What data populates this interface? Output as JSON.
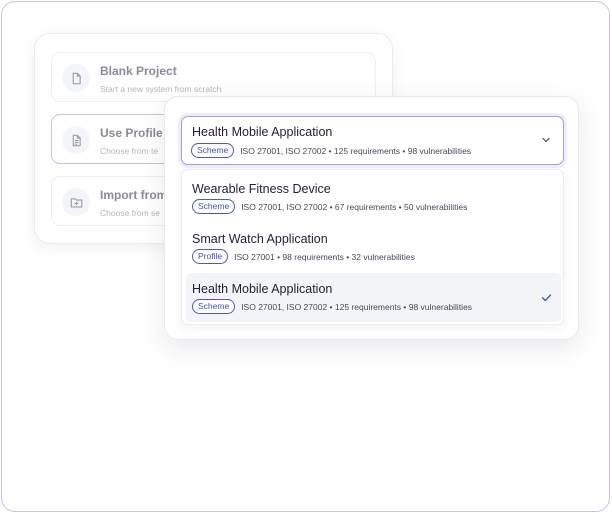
{
  "colors": {
    "accent": "#4a58c4",
    "frame_border": "#c9c3e6",
    "selected_border": "#a59ee0",
    "active_row": "#f3f4f8"
  },
  "project_options": [
    {
      "title": "Blank Project",
      "subtitle": "Start a new system from scratch",
      "icon": "document-icon"
    },
    {
      "title": "Use Profile o",
      "subtitle": "Choose from te",
      "icon": "document-text-icon"
    },
    {
      "title": "Import from",
      "subtitle": "Choose from se",
      "icon": "folder-plus-icon"
    }
  ],
  "select": {
    "title": "Health Mobile Application",
    "chip": "Scheme",
    "meta": "ISO 27001, ISO 27002 • 125 requirements • 98 vulnerabilities",
    "icon": "chevron-down-icon"
  },
  "menu_items": [
    {
      "title": "Wearable Fitness Device",
      "chip": "Scheme",
      "meta": "ISO 27001, ISO 27002 • 67 requirements • 50 vulnerabilities",
      "selected": false
    },
    {
      "title": "Smart Watch Application",
      "chip": "Profile",
      "meta": "ISO 27001 • 98 requirements • 32 vulnerabilities",
      "selected": false
    },
    {
      "title": "Health Mobile Application",
      "chip": "Scheme",
      "meta": "ISO 27001, ISO 27002 • 125 requirements • 98 vulnerabilities",
      "selected": true
    }
  ]
}
